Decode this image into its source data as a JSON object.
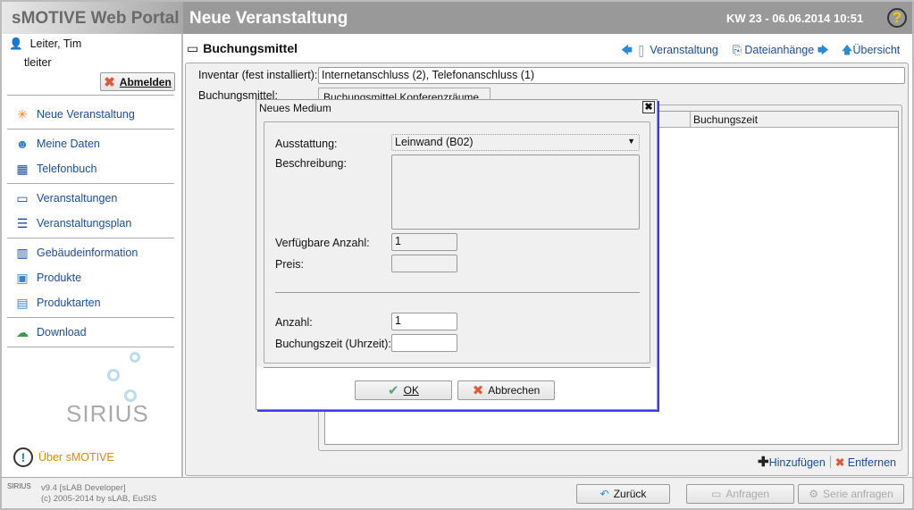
{
  "app": {
    "title": "sMOTIVE Web Portal",
    "page_title": "Neue Veranstaltung",
    "datetime": "KW 23 - 06.06.2014 10:51"
  },
  "user": {
    "name": "Leiter, Tim",
    "login": "tleiter",
    "logout_label": "Abmelden"
  },
  "sidebar": {
    "items": [
      {
        "label": "Neue Veranstaltung",
        "icon": "presentation-new-icon"
      },
      {
        "label": "Meine Daten",
        "icon": "user-icon"
      },
      {
        "label": "Telefonbuch",
        "icon": "phonebook-icon"
      },
      {
        "label": "Veranstaltungen",
        "icon": "presentation-icon"
      },
      {
        "label": "Veranstaltungsplan",
        "icon": "schedule-icon"
      },
      {
        "label": "Gebäudeinformation",
        "icon": "building-icon"
      },
      {
        "label": "Produkte",
        "icon": "product-icon"
      },
      {
        "label": "Produktarten",
        "icon": "product-types-icon"
      },
      {
        "label": "Download",
        "icon": "download-icon"
      }
    ],
    "logo_text": "SIRIUS",
    "about_label": "Über sMOTIVE"
  },
  "section": {
    "title": "Buchungsmittel",
    "nav": {
      "back": "Veranstaltung",
      "forward": "Dateianhänge",
      "overview": "Übersicht"
    }
  },
  "form": {
    "inventar_label": "Inventar (fest installiert):",
    "inventar_value": "Internetanschluss (2), Telefonanschluss (1)",
    "buchungsmittel_label": "Buchungsmittel:",
    "tab": "Buchungsmittel Konferenzräume",
    "column_buchungszeit": "Buchungszeit",
    "add_label": "Hinzufügen",
    "remove_label": "Entfernen"
  },
  "dialog": {
    "title": "Neues Medium",
    "ausstattung_label": "Ausstattung:",
    "ausstattung_value": "Leinwand (B02)",
    "beschreibung_label": "Beschreibung:",
    "beschreibung_value": "",
    "verfuegbar_label": "Verfügbare Anzahl:",
    "verfuegbar_value": "1",
    "preis_label": "Preis:",
    "preis_value": "",
    "anzahl_label": "Anzahl:",
    "anzahl_value": "1",
    "buchungszeit_label": "Buchungszeit (Uhrzeit):",
    "buchungszeit_value": "",
    "ok_label": "OK",
    "cancel_label": "Abbrechen"
  },
  "footer": {
    "version": "v9.4 [sLAB Developer]",
    "copyright": "(c) 2005-2014 by sLAB, EuSIS",
    "back_label": "Zurück",
    "request_label": "Anfragen",
    "series_label": "Serie anfragen"
  },
  "colors": {
    "link": "#1a4c9c",
    "accent_orange": "#e08a00",
    "header_gray": "#999999"
  }
}
